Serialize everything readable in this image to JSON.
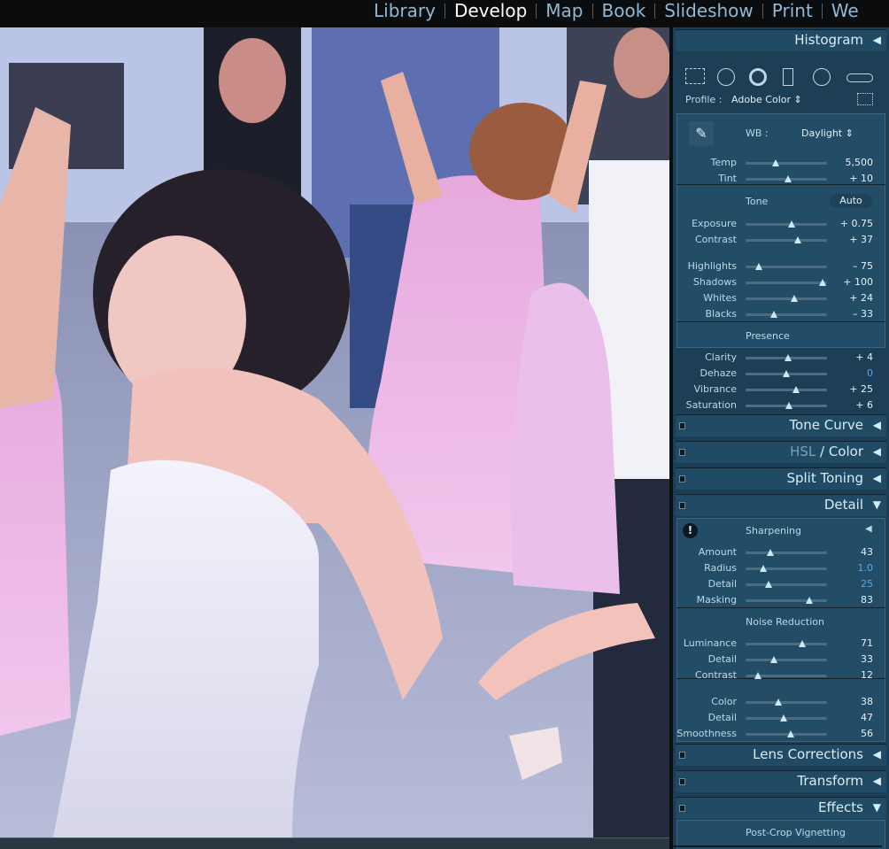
{
  "modules": [
    "Library",
    "Develop",
    "Map",
    "Book",
    "Slideshow",
    "Print",
    "We"
  ],
  "active_module": "Develop",
  "panel": {
    "histogram": {
      "title": "Histogram",
      "arrow": "◀"
    },
    "basic": {
      "profile_label": "Profile :",
      "profile_value": "Adobe Color",
      "wb_label": "WB :",
      "wb_value": "Daylight",
      "tone_label": "Tone",
      "auto_label": "Auto",
      "presence_label": "Presence",
      "sliders": [
        {
          "label": "Temp",
          "value": "5,500"
        },
        {
          "label": "Tint",
          "value": "+ 10"
        },
        {
          "label": "Exposure",
          "value": "+ 0.75"
        },
        {
          "label": "Contrast",
          "value": "+ 37"
        },
        {
          "label": "Highlights",
          "value": "– 75"
        },
        {
          "label": "Shadows",
          "value": "+ 100"
        },
        {
          "label": "Whites",
          "value": "+ 24"
        },
        {
          "label": "Blacks",
          "value": "– 33"
        },
        {
          "label": "Clarity",
          "value": "+ 4"
        },
        {
          "label": "Dehaze",
          "value": "0"
        },
        {
          "label": "Vibrance",
          "value": "+ 25"
        },
        {
          "label": "Saturation",
          "value": "+ 6"
        }
      ]
    },
    "collapsed_top": [
      {
        "title": "Tone Curve",
        "arrow": "◀"
      },
      {
        "title_a": "HSL",
        "title_sep": " / ",
        "title_b": "Color",
        "arrow": "◀"
      },
      {
        "title": "Split Toning",
        "arrow": "◀"
      }
    ],
    "detail": {
      "title": "Detail",
      "arrow": "▼",
      "sharpening_label": "Sharpening",
      "noise_label": "Noise Reduction",
      "sharpening": [
        {
          "label": "Amount",
          "value": "43"
        },
        {
          "label": "Radius",
          "value": "1.0"
        },
        {
          "label": "Detail",
          "value": "25"
        },
        {
          "label": "Masking",
          "value": "83"
        }
      ],
      "noise": [
        {
          "label": "Luminance",
          "value": "71"
        },
        {
          "label": "Detail",
          "value": "33"
        },
        {
          "label": "Contrast",
          "value": "12"
        },
        {
          "label": "Color",
          "value": "38"
        },
        {
          "label": "Detail",
          "value": "47"
        },
        {
          "label": "Smoothness",
          "value": "56"
        }
      ]
    },
    "collapsed_bottom": [
      {
        "title": "Lens Corrections",
        "arrow": "◀"
      },
      {
        "title": "Transform",
        "arrow": "◀"
      }
    ],
    "effects": {
      "title": "Effects",
      "arrow": "▼",
      "vignette_label": "Post-Crop Vignetting"
    }
  },
  "colors": {
    "panel_bg": "#1c3f55",
    "header_bg": "#214a64",
    "value_blue": "#5ea7dc",
    "active_module": "#ffffff",
    "inactive_module": "#8fb9d6"
  }
}
